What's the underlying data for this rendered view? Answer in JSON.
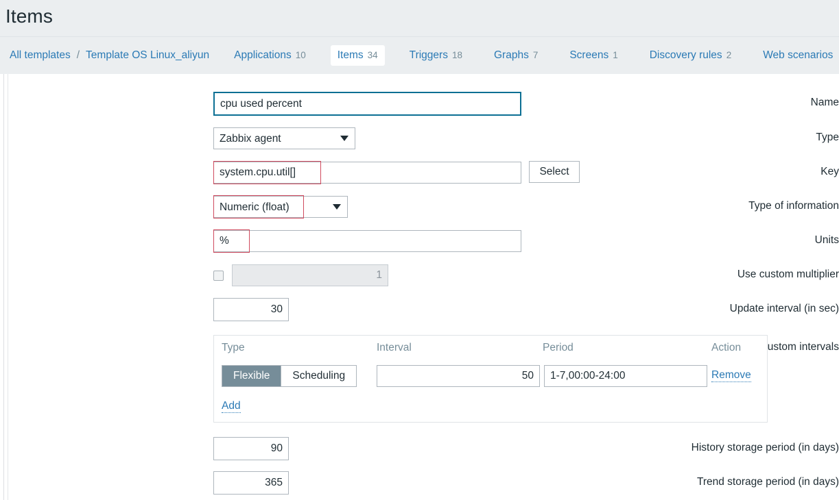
{
  "page": {
    "title": "Items"
  },
  "nav": {
    "breadcrumb": [
      {
        "label": "All templates",
        "name": "all-templates"
      },
      {
        "label": "Template OS Linux_aliyun",
        "name": "template-os-linux-aliyun"
      }
    ],
    "separator": "/",
    "tabs": [
      {
        "label": "Applications",
        "count": "10",
        "active": false,
        "name": "applications"
      },
      {
        "label": "Items",
        "count": "34",
        "active": true,
        "name": "items"
      },
      {
        "label": "Triggers",
        "count": "18",
        "active": false,
        "name": "triggers"
      },
      {
        "label": "Graphs",
        "count": "7",
        "active": false,
        "name": "graphs"
      },
      {
        "label": "Screens",
        "count": "1",
        "active": false,
        "name": "screens"
      },
      {
        "label": "Discovery rules",
        "count": "2",
        "active": false,
        "name": "discovery-rules"
      },
      {
        "label": "Web scenarios",
        "count": "",
        "active": false,
        "name": "web-scenarios"
      }
    ]
  },
  "form": {
    "name": {
      "label": "Name",
      "value": "cpu used percent",
      "placeholder": ""
    },
    "type": {
      "label": "Type",
      "value": "Zabbix agent",
      "options": [
        "Zabbix agent"
      ]
    },
    "key": {
      "label": "Key",
      "value": "system.cpu.util[]",
      "placeholder": "",
      "select_button": "Select"
    },
    "type_of_information": {
      "label": "Type of information",
      "value": "Numeric (float)",
      "options": [
        "Numeric (float)"
      ]
    },
    "units": {
      "label": "Units",
      "value": "%",
      "placeholder": ""
    },
    "use_custom_multiplier": {
      "label": "Use custom multiplier",
      "checked": false,
      "value": "1",
      "disabled": true
    },
    "update_interval": {
      "label": "Update interval (in sec)",
      "value": "30"
    },
    "custom_intervals": {
      "label": "Custom intervals",
      "columns": [
        "Type",
        "Interval",
        "Period",
        "Action"
      ],
      "rows": [
        {
          "type_flexible": "Flexible",
          "type_scheduling": "Scheduling",
          "selected_type": "Flexible",
          "interval": "50",
          "period": "1-7,00:00-24:00",
          "action": "Remove"
        }
      ],
      "add_label": "Add"
    },
    "history_storage_period": {
      "label": "History storage period (in days)",
      "value": "90"
    },
    "trend_storage_period": {
      "label": "Trend storage period (in days)",
      "value": "365"
    }
  },
  "colors": {
    "header_bg": "#ebeef0",
    "link": "#2b7ab5",
    "muted": "#768d99",
    "text": "#1f2c33",
    "focus_border": "#0b6f93",
    "annotation": "#d04a5e",
    "segment_on_bg": "#768d99"
  }
}
